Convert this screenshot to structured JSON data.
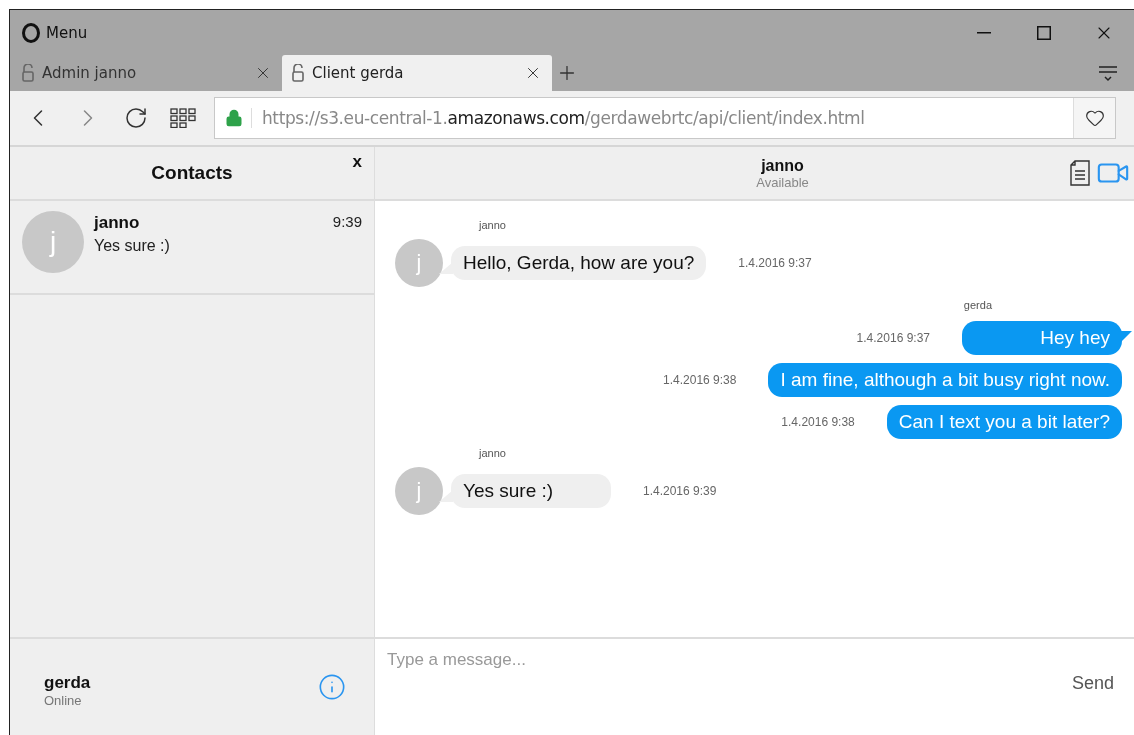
{
  "browser": {
    "menu_label": "Menu",
    "tabs": [
      {
        "title": "Admin janno",
        "selected": false
      },
      {
        "title": "Client gerda",
        "selected": true
      }
    ],
    "url": {
      "scheme_and_subdomain": "https://s3.eu-central-1.",
      "domain": "amazonaws.com",
      "path": "/gerdawebrtc/api/client/index.html"
    }
  },
  "contacts_panel": {
    "title": "Contacts",
    "close_label": "x",
    "contacts": [
      {
        "avatar_letter": "j",
        "name": "janno",
        "preview": "Yes sure :)",
        "time": "9:39",
        "selected": false
      }
    ],
    "current_user": {
      "name": "gerda",
      "status": "Online"
    }
  },
  "chat": {
    "header": {
      "name": "janno",
      "status": "Available"
    },
    "messages": [
      {
        "kind": "incoming",
        "sender": "janno",
        "avatar_letter": "j",
        "text": "Hello, Gerda, how are you?",
        "time": "1.4.2016 9:37"
      },
      {
        "kind": "outgoing",
        "sender": "gerda",
        "text": "Hey hey",
        "time": "1.4.2016 9:37"
      },
      {
        "kind": "outgoing",
        "text": "I am fine, although a bit busy right now.",
        "time": "1.4.2016 9:38"
      },
      {
        "kind": "outgoing",
        "text": "Can I text you a bit later?",
        "time": "1.4.2016 9:38"
      },
      {
        "kind": "incoming",
        "sender": "janno",
        "avatar_letter": "j",
        "text": "Yes sure :)",
        "time": "1.4.2016 9:39"
      }
    ],
    "composer": {
      "placeholder": "Type a message...",
      "send_label": "Send"
    }
  }
}
